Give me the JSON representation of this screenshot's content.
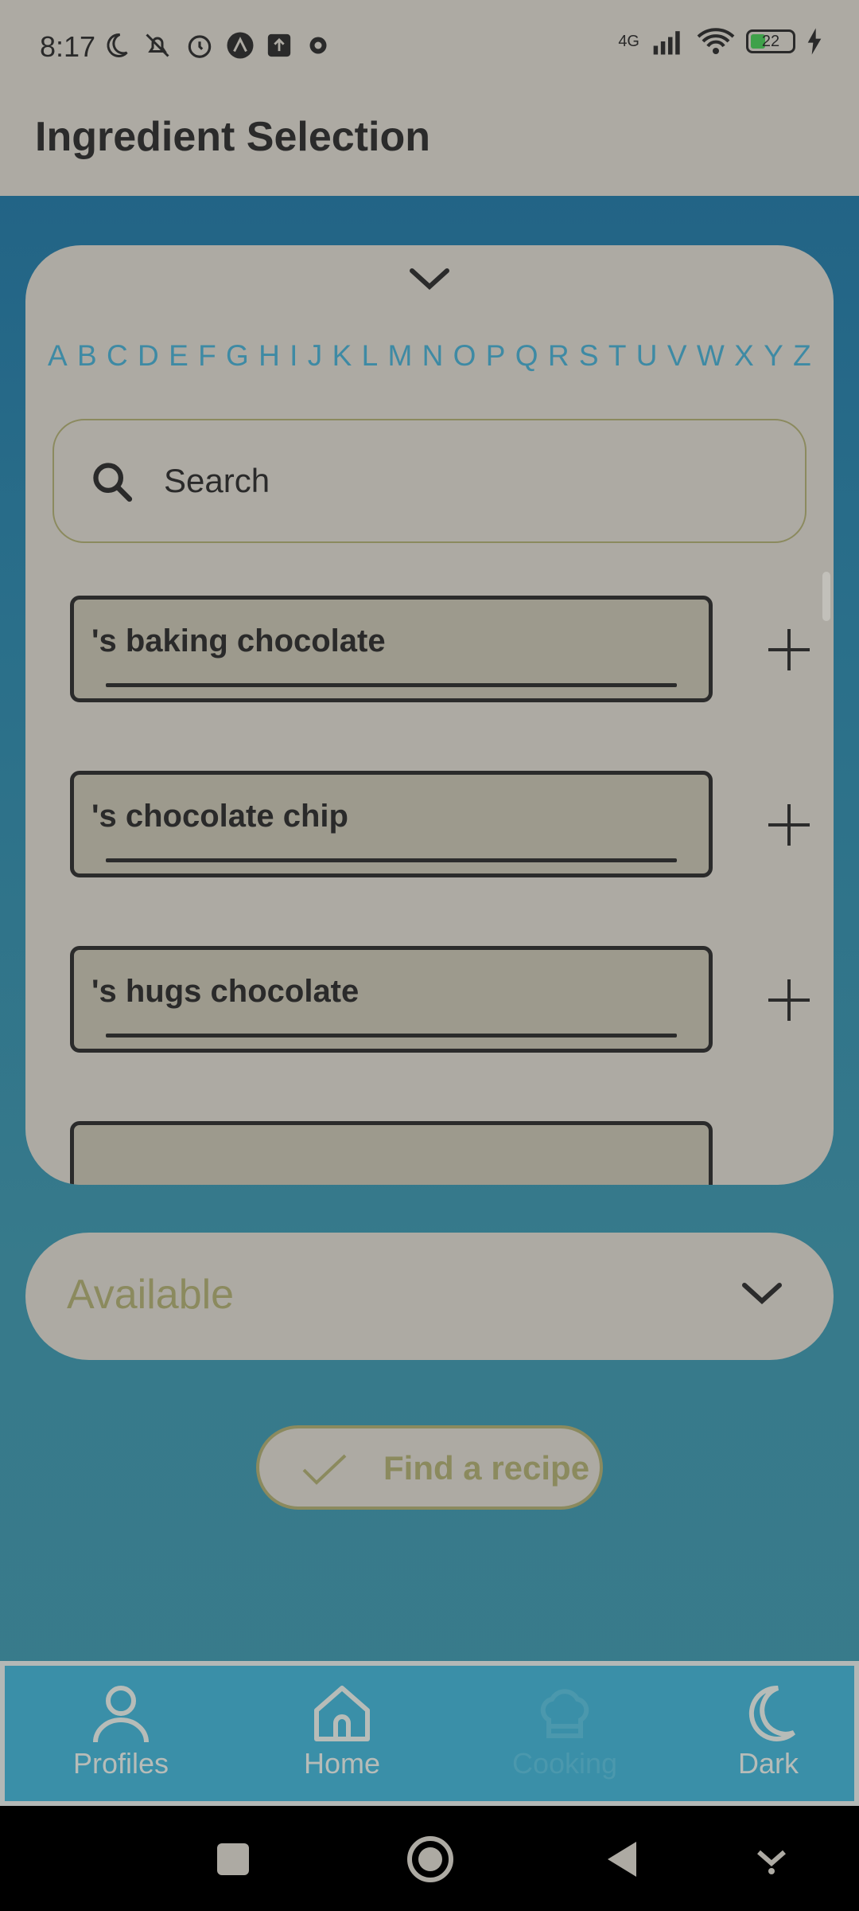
{
  "status": {
    "time": "8:17",
    "network": "4G",
    "battery": "22"
  },
  "header": {
    "title": "Ingredient Selection"
  },
  "alphabet": [
    "A",
    "B",
    "C",
    "D",
    "E",
    "F",
    "G",
    "H",
    "I",
    "J",
    "K",
    "L",
    "M",
    "N",
    "O",
    "P",
    "Q",
    "R",
    "S",
    "T",
    "U",
    "V",
    "W",
    "X",
    "Y",
    "Z"
  ],
  "search": {
    "placeholder": "Search",
    "value": ""
  },
  "ingredients": [
    {
      "label": "'s baking chocolate"
    },
    {
      "label": "'s chocolate chip"
    },
    {
      "label": "'s hugs chocolate"
    },
    {
      "label": ""
    }
  ],
  "available": {
    "label": "Available"
  },
  "find": {
    "label": "Find a recipe"
  },
  "nav": {
    "profiles": "Profiles",
    "home": "Home",
    "cooking": "Cooking",
    "dark": "Dark"
  },
  "colors": {
    "card": "#adaaa3",
    "accent_olive": "#8b8a5e",
    "alphabet": "#3e8aa4",
    "nav_bg": "#3a8fa8"
  }
}
